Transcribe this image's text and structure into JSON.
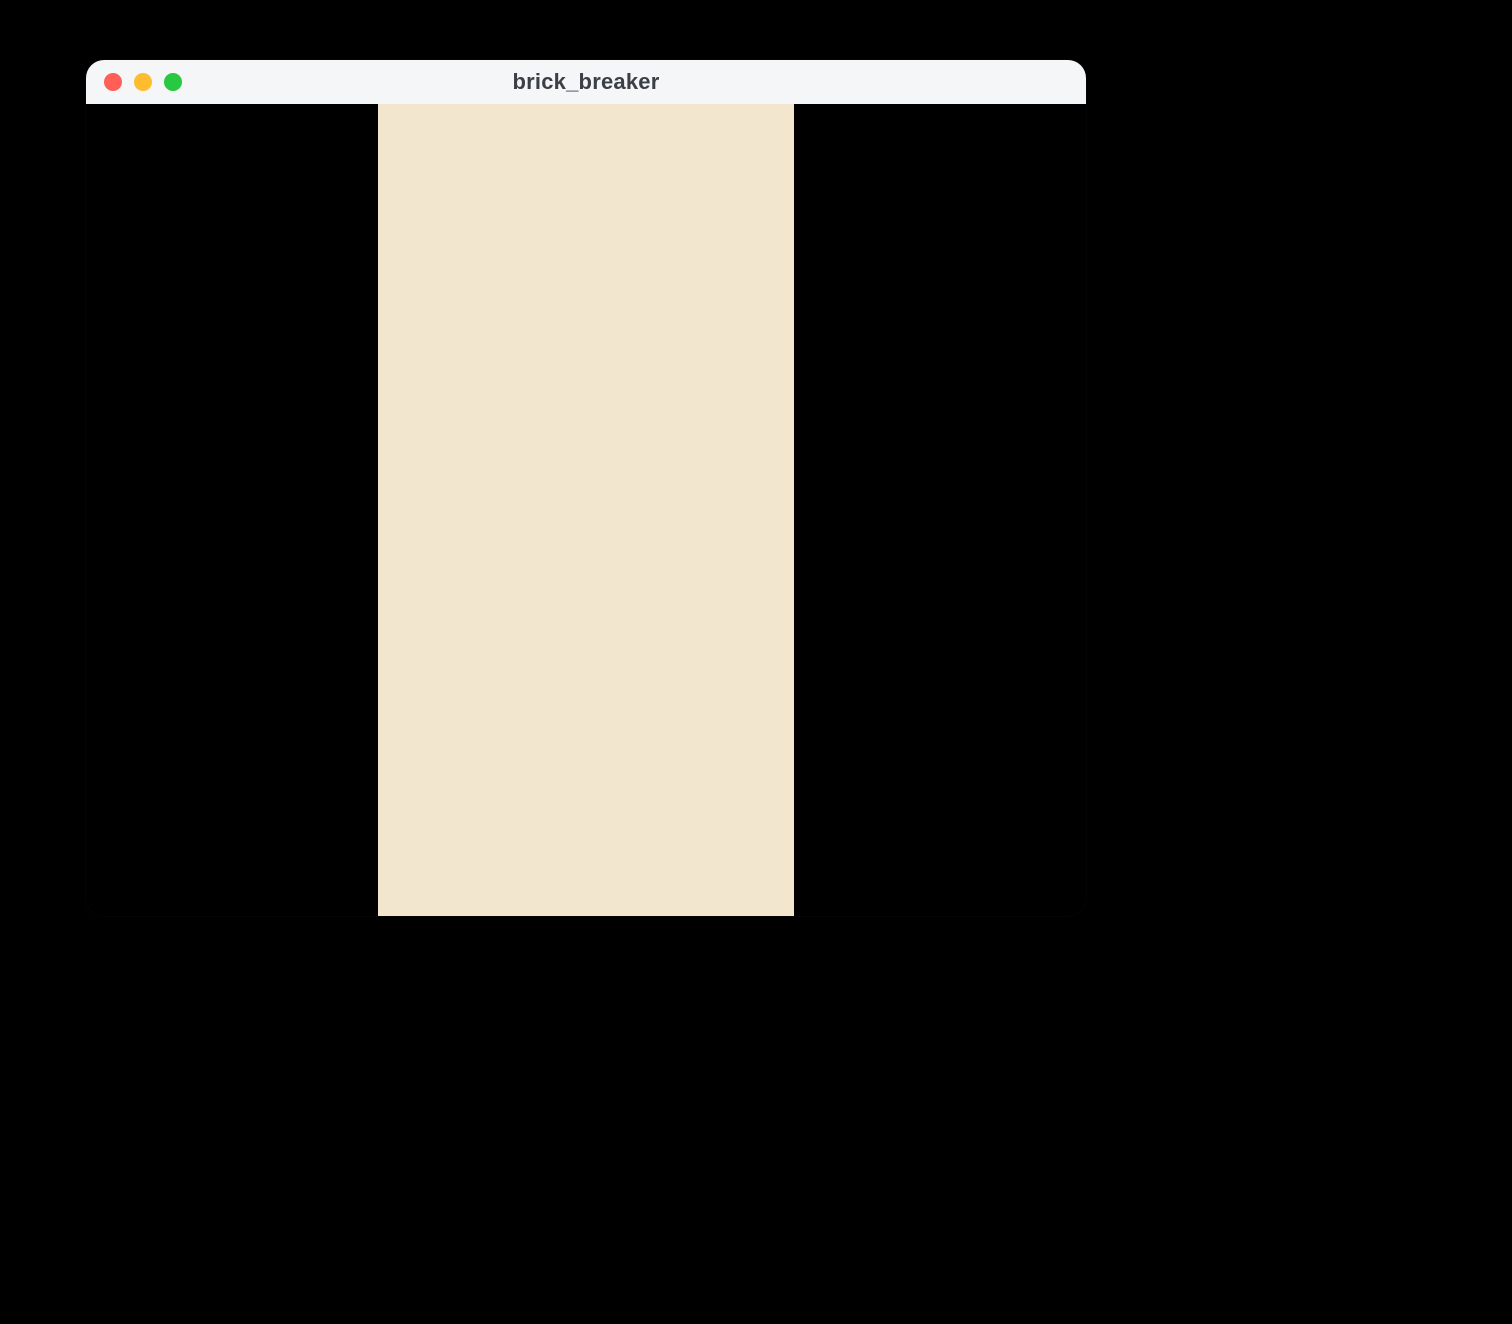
{
  "window": {
    "title": "brick_breaker"
  },
  "traffic_lights": {
    "close": "close-icon",
    "minimize": "minimize-icon",
    "zoom": "zoom-icon"
  },
  "colors": {
    "desktop_background": "#000000",
    "titlebar_background": "#f4f6f8",
    "title_text": "#3a4046",
    "game_canvas": "#f2e7ce",
    "content_background": "#000000",
    "traffic_close": "#ff5f57",
    "traffic_minimize": "#febc2e",
    "traffic_zoom": "#28c840"
  }
}
